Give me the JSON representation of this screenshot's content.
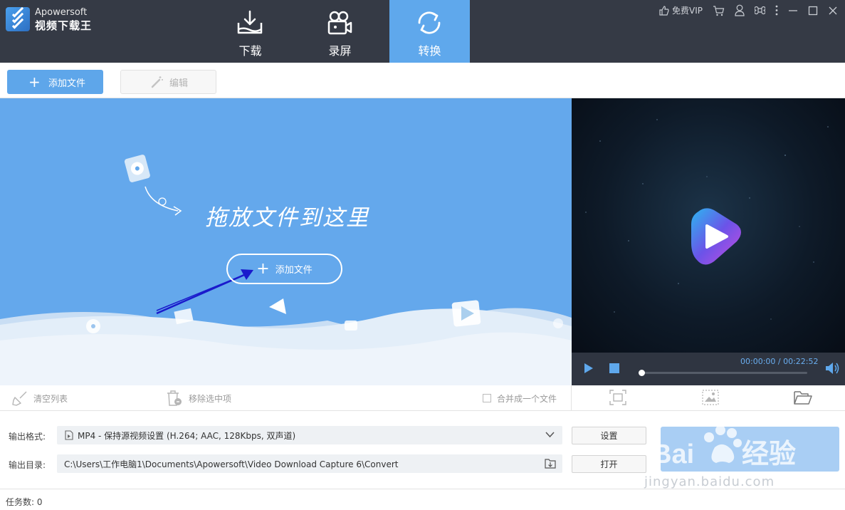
{
  "app": {
    "brand_en": "Apowersoft",
    "brand_cn": "视频下载王"
  },
  "nav": {
    "tabs": [
      {
        "label": "下载",
        "icon": "download-icon",
        "active": false
      },
      {
        "label": "录屏",
        "icon": "camera-icon",
        "active": false
      },
      {
        "label": "转换",
        "icon": "convert-icon",
        "active": true
      }
    ]
  },
  "window_controls": {
    "vip_label": "免费VIP",
    "icons": [
      "thumbs-up-icon",
      "cart-icon",
      "user-icon",
      "command-icon",
      "more-icon",
      "minimize-icon",
      "maximize-icon",
      "close-icon"
    ]
  },
  "toolbar": {
    "add_file_label": "添加文件",
    "edit_label": "编辑"
  },
  "drop_zone": {
    "hint": "拖放文件到这里",
    "add_file_label": "添加文件"
  },
  "player": {
    "time_display": "00:00:00 / 00:22:52",
    "progress": 0.0
  },
  "list_actions": {
    "clear_label": "清空列表",
    "remove_label": "移除选中项",
    "merge_label": "合并成一个文件",
    "merge_checked": false
  },
  "output": {
    "format_label": "输出格式:",
    "format_value": "MP4 - 保持源视频设置 (H.264; AAC, 128Kbps, 双声道)",
    "settings_label": "设置",
    "dir_label": "输出目录:",
    "dir_value": "C:\\Users\\工作电脑1\\Documents\\Apowersoft\\Video Download Capture 6\\Convert",
    "open_label": "打开"
  },
  "status": {
    "task_count_label": "任务数: 0"
  },
  "watermark": {
    "text": "Baidu经验",
    "url": "jingyan.baidu.com"
  },
  "colors": {
    "topbar": "#353a45",
    "accent": "#5fa8ec",
    "drop_bg": "#64a8ec",
    "player_bar": "#2f3541",
    "arrow": "#1a1acc"
  }
}
